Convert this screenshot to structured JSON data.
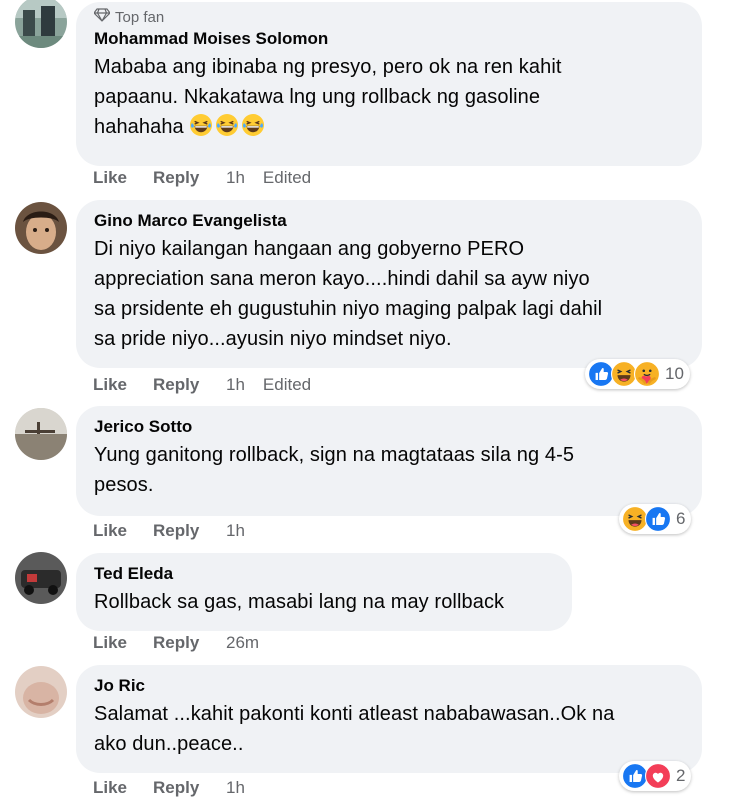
{
  "comments": [
    {
      "badge": "Top fan",
      "author": "Mohammad Moises Solomon",
      "text_lines": [
        "Mababa ang ibinaba ng presyo, pero ok na ren kahit",
        "papaanu. Nkakatawa lng ung rollback ng gasoline",
        "hahahaha"
      ],
      "emojis": [
        "laughing-emoji",
        "laughing-emoji",
        "laughing-emoji"
      ],
      "actions": {
        "like": "Like",
        "reply": "Reply",
        "time": "1h",
        "edited": "Edited"
      }
    },
    {
      "author": "Gino Marco Evangelista",
      "text_lines": [
        "Di niyo kailangan hangaan ang gobyerno PERO",
        "appreciation sana meron kayo....hindi dahil sa ayw niyo",
        "sa prsidente eh gugustuhin niyo maging palpak lagi dahil",
        "sa pride niyo...ayusin niyo mindset niyo."
      ],
      "actions": {
        "like": "Like",
        "reply": "Reply",
        "time": "1h",
        "edited": "Edited"
      },
      "reactions": {
        "icons": [
          "like-reaction-icon",
          "haha-reaction-icon",
          "care-reaction-icon"
        ],
        "count": "10"
      }
    },
    {
      "author": "Jerico Sotto",
      "text_lines": [
        "Yung ganitong rollback, sign na magtataas sila ng 4-5",
        "pesos."
      ],
      "actions": {
        "like": "Like",
        "reply": "Reply",
        "time": "1h"
      },
      "reactions": {
        "icons": [
          "haha-reaction-icon",
          "like-reaction-icon"
        ],
        "count": "6"
      }
    },
    {
      "author": "Ted Eleda",
      "text_lines": [
        "Rollback sa gas, masabi lang na may rollback"
      ],
      "actions": {
        "like": "Like",
        "reply": "Reply",
        "time": "26m"
      }
    },
    {
      "author": "Jo Ric",
      "text_lines": [
        "Salamat ...kahit pakonti konti atleast nababawasan..Ok na",
        "ako dun..peace.."
      ],
      "actions": {
        "like": "Like",
        "reply": "Reply",
        "time": "1h"
      },
      "reactions": {
        "icons": [
          "like-reaction-icon",
          "love-reaction-icon"
        ],
        "count": "2"
      }
    }
  ],
  "colors": {
    "bubble": "#f0f2f5",
    "meta": "#65676b",
    "like_blue": "#1877f2",
    "love_red": "#f33e58",
    "haha_yellow": "#f7b125"
  }
}
